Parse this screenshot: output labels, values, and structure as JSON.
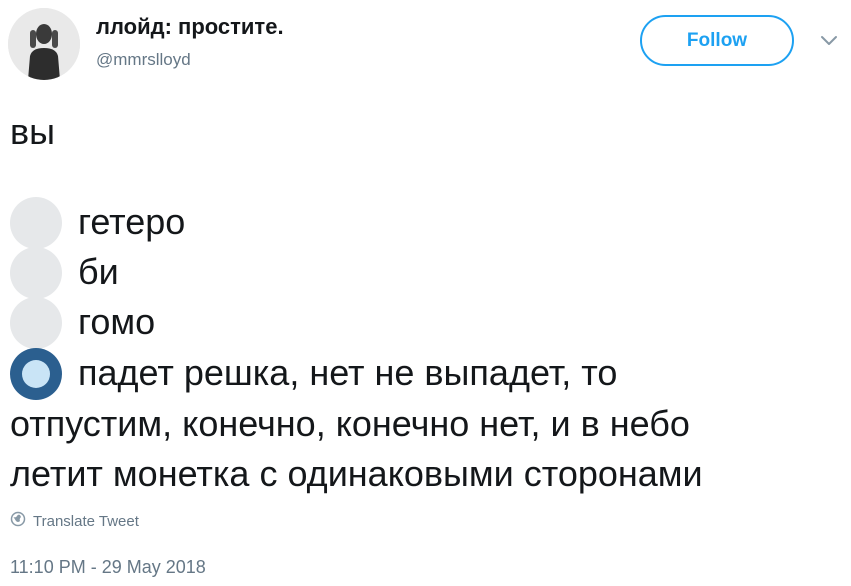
{
  "author": {
    "display_name": "ллойд: простите.",
    "username": "@mmrslloyd",
    "avatar_icon": "user-avatar"
  },
  "follow_button": {
    "label": "Follow",
    "color": "#1da1f2"
  },
  "menu": {
    "icon": "chevron-down-icon"
  },
  "tweet": {
    "intro": "вы",
    "poll_options": [
      {
        "label": "гетеро",
        "selected": false
      },
      {
        "label": "би",
        "selected": false
      },
      {
        "label": "гомо",
        "selected": false
      },
      {
        "label": "падет решка, нет не выпадет, то",
        "continuation": [
          "отпустим, конечно, конечно нет, и в небо",
          "летит монетка с одинаковыми сторонами"
        ],
        "selected": true
      }
    ],
    "selected_color": "#2b5f8f",
    "unselected_color": "#e6e8ea"
  },
  "translate": {
    "label": "Translate Tweet",
    "icon": "globe-icon"
  },
  "timestamp": "11:10 PM - 29 May 2018"
}
